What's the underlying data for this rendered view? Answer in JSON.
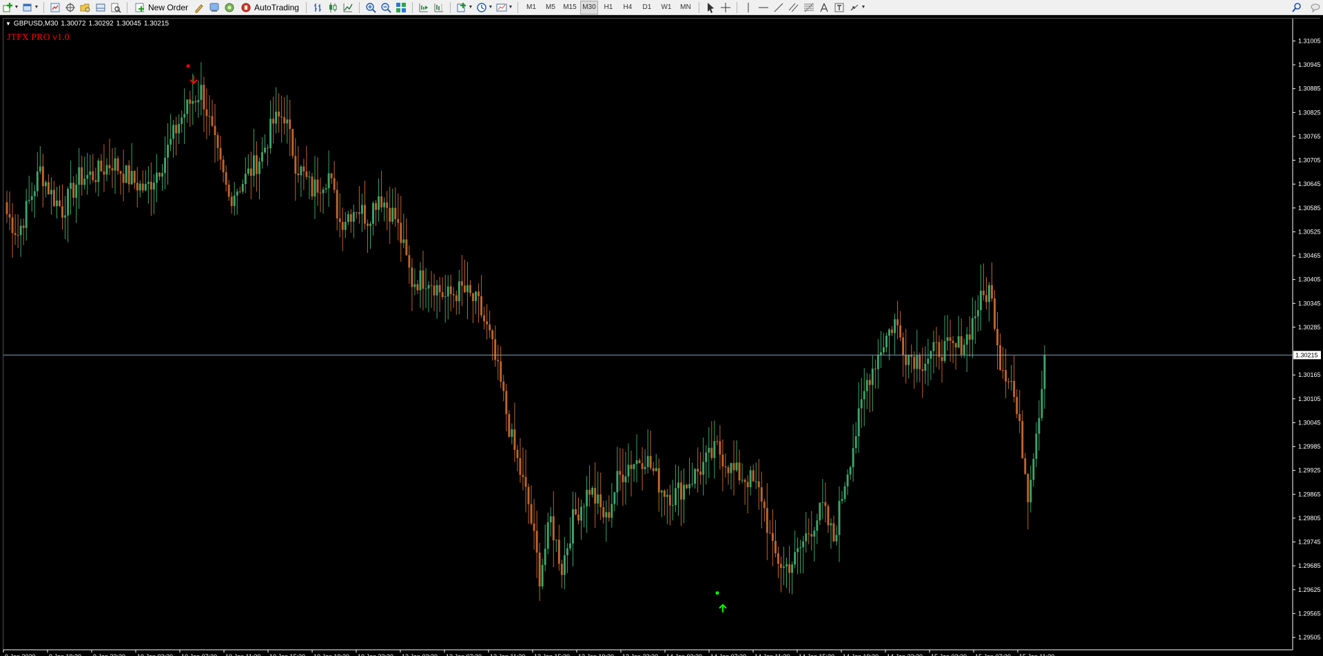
{
  "toolbar": {
    "new_order_label": "New Order",
    "autotrading_label": "AutoTrading",
    "timeframes": [
      "M1",
      "M5",
      "M15",
      "M30",
      "H1",
      "H4",
      "D1",
      "W1",
      "MN"
    ],
    "active_timeframe": "M30"
  },
  "chart": {
    "symbol_timeframe": "GBPUSD,M30",
    "open": "1.30072",
    "high": "1.30292",
    "low": "1.30045",
    "close": "1.30215",
    "indicator_label": "JTFX PRO v1.0",
    "current_price_label": "1.30215"
  },
  "chart_data": {
    "type": "candlestick",
    "symbol": "GBPUSD",
    "timeframe": "M30",
    "ylim": [
      1.29505,
      1.3103
    ],
    "y_ticks": [
      "1.31005",
      "1.30945",
      "1.30885",
      "1.30825",
      "1.30765",
      "1.30705",
      "1.30645",
      "1.30585",
      "1.30525",
      "1.30465",
      "1.30405",
      "1.30345",
      "1.30285",
      "1.30165",
      "1.30105",
      "1.30045",
      "1.29985",
      "1.29925",
      "1.29865",
      "1.29805",
      "1.29745",
      "1.29685",
      "1.29625",
      "1.29565",
      "1.29505"
    ],
    "x_ticks": [
      "9 Jan 2020",
      "9 Jan 19:30",
      "9 Jan 23:30",
      "10 Jan 03:30",
      "10 Jan 07:30",
      "10 Jan 11:30",
      "10 Jan 15:30",
      "10 Jan 19:30",
      "10 Jan 23:30",
      "13 Jan 03:30",
      "13 Jan 07:30",
      "13 Jan 11:30",
      "13 Jan 15:30",
      "13 Jan 19:30",
      "13 Jan 23:30",
      "14 Jan 03:30",
      "14 Jan 07:30",
      "14 Jan 11:30",
      "14 Jan 15:30",
      "14 Jan 19:30",
      "14 Jan 23:30",
      "15 Jan 03:30",
      "15 Jan 07:30",
      "15 Jan 11:30"
    ],
    "current_price": 1.30215,
    "bull_color": "#3ca66b",
    "bear_color": "#c0662c",
    "grid": false,
    "signals": [
      {
        "type": "sell",
        "color": "#ff0000",
        "x_tick": "10 Jan 07:30",
        "price": 1.3089
      },
      {
        "type": "buy",
        "color": "#00ff00",
        "x_tick": "14 Jan 07:30",
        "price": 1.2962
      }
    ],
    "anchors": [
      [
        0,
        1.3057
      ],
      [
        4,
        1.3052
      ],
      [
        8,
        1.306
      ],
      [
        12,
        1.3068
      ],
      [
        16,
        1.3062
      ],
      [
        20,
        1.3058
      ],
      [
        26,
        1.3066
      ],
      [
        32,
        1.3067
      ],
      [
        38,
        1.307
      ],
      [
        44,
        1.3066
      ],
      [
        50,
        1.3063
      ],
      [
        56,
        1.307
      ],
      [
        62,
        1.308
      ],
      [
        66,
        1.3085
      ],
      [
        70,
        1.3088
      ],
      [
        72,
        1.3083
      ],
      [
        76,
        1.3071
      ],
      [
        80,
        1.3061
      ],
      [
        86,
        1.3066
      ],
      [
        92,
        1.3072
      ],
      [
        96,
        1.308
      ],
      [
        100,
        1.3082
      ],
      [
        104,
        1.307
      ],
      [
        110,
        1.3063
      ],
      [
        116,
        1.3067
      ],
      [
        120,
        1.3055
      ],
      [
        126,
        1.3059
      ],
      [
        130,
        1.3056
      ],
      [
        134,
        1.3062
      ],
      [
        140,
        1.3056
      ],
      [
        146,
        1.304
      ],
      [
        152,
        1.3041
      ],
      [
        158,
        1.3036
      ],
      [
        164,
        1.3038
      ],
      [
        170,
        1.3034
      ],
      [
        174,
        1.3026
      ],
      [
        178,
        1.3014
      ],
      [
        182,
        1.3
      ],
      [
        188,
        1.2984
      ],
      [
        192,
        1.2966
      ],
      [
        196,
        1.298
      ],
      [
        200,
        1.2968
      ],
      [
        204,
        1.298
      ],
      [
        210,
        1.2988
      ],
      [
        216,
        1.298
      ],
      [
        220,
        1.299
      ],
      [
        224,
        1.2994
      ],
      [
        230,
        1.2996
      ],
      [
        236,
        1.2988
      ],
      [
        240,
        1.2986
      ],
      [
        246,
        1.299
      ],
      [
        250,
        1.2993
      ],
      [
        256,
        1.2998
      ],
      [
        262,
        1.2992
      ],
      [
        268,
        1.299
      ],
      [
        272,
        1.2986
      ],
      [
        276,
        1.2972
      ],
      [
        280,
        1.2968
      ],
      [
        284,
        1.297
      ],
      [
        288,
        1.2976
      ],
      [
        294,
        1.2983
      ],
      [
        298,
        1.2975
      ],
      [
        302,
        1.299
      ],
      [
        306,
        1.3002
      ],
      [
        310,
        1.3015
      ],
      [
        316,
        1.3025
      ],
      [
        320,
        1.303
      ],
      [
        324,
        1.3022
      ],
      [
        330,
        1.302
      ],
      [
        336,
        1.3023
      ],
      [
        342,
        1.3023
      ],
      [
        346,
        1.3026
      ],
      [
        350,
        1.3034
      ],
      [
        354,
        1.3038
      ],
      [
        356,
        1.3031
      ],
      [
        358,
        1.302
      ],
      [
        362,
        1.3015
      ],
      [
        366,
        1.2998
      ],
      [
        368,
        1.2987
      ],
      [
        372,
        1.3008
      ],
      [
        374,
        1.302
      ]
    ]
  }
}
